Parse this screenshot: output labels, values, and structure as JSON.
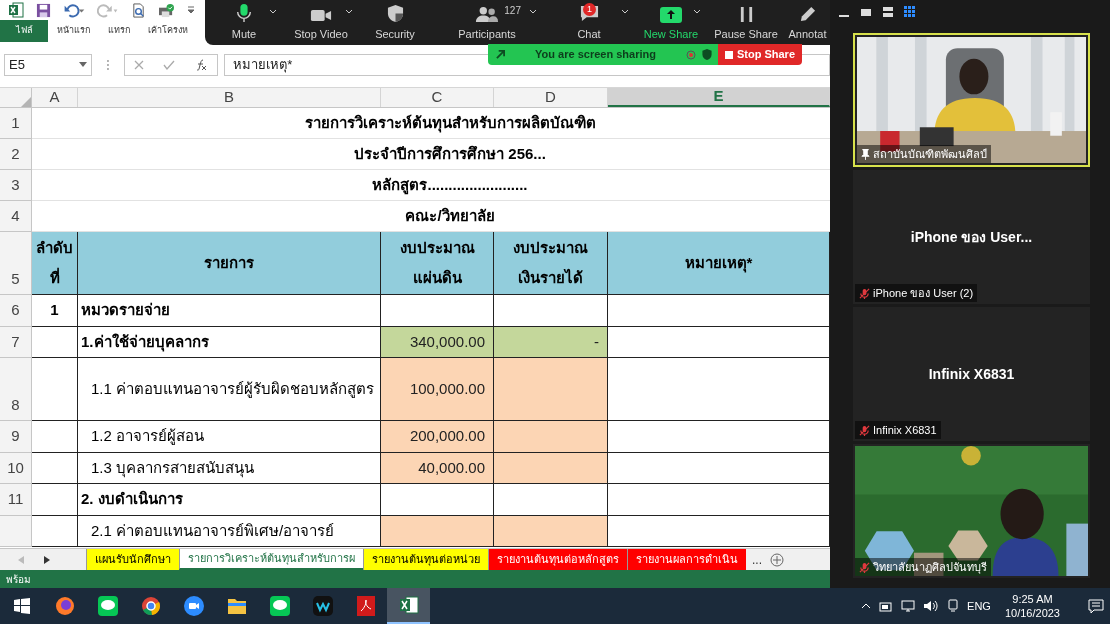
{
  "excel": {
    "ribbon_tabs": [
      {
        "label": "ไฟล์",
        "selected": true
      },
      {
        "label": "หน้าแรก",
        "selected": false
      },
      {
        "label": "แทรก",
        "selected": false
      },
      {
        "label": "เค้าโครงห",
        "selected": false
      }
    ],
    "name_box": "E5",
    "formula": "หมายเหตุ*",
    "columns": [
      {
        "label": "A",
        "selected": false
      },
      {
        "label": "B",
        "selected": false
      },
      {
        "label": "C",
        "selected": false
      },
      {
        "label": "D",
        "selected": false
      },
      {
        "label": "E",
        "selected": true
      }
    ],
    "rows": [
      {
        "number": "1",
        "kind": "title",
        "text": "รายการวิเคราะห์ต้นทุนสำหรับการผลิตบัณฑิต"
      },
      {
        "number": "2",
        "kind": "title",
        "text": "ประจำปีการศึการศึกษา 256..."
      },
      {
        "number": "3",
        "kind": "title",
        "text": "หลักสูตร........................"
      },
      {
        "number": "4",
        "kind": "title",
        "text": "คณะ/วิทยาลัย"
      },
      {
        "number": "5",
        "kind": "header",
        "cells": [
          [
            "ลำดับ",
            "ที่"
          ],
          [
            "รายการ"
          ],
          [
            "งบประมาณ",
            "แผ่นดิน"
          ],
          [
            "งบประมาณ",
            "เงินรายได้"
          ],
          [
            "หมายเหตุ*"
          ]
        ]
      },
      {
        "number": "6",
        "kind": "data",
        "tall": false,
        "no": "1",
        "item": {
          "text": "หมวดรายจ่าย",
          "kind": "section"
        }
      },
      {
        "number": "7",
        "kind": "data",
        "tall": false,
        "item": {
          "text": "1.ค่าใช้จ่ายบุคลากร",
          "kind": "section"
        },
        "amounts": [
          {
            "text": "340,000.00",
            "color": "#c4d79b"
          },
          {
            "text": "-",
            "color": "#c4d79b"
          }
        ]
      },
      {
        "number": "8",
        "kind": "data",
        "tall": true,
        "item": {
          "text": "1.1 ค่าตอบแทนอาจารย์ผู้รับผิดชอบหลักสูตร",
          "kind": "subitem"
        },
        "amounts": [
          {
            "text": "100,000.00",
            "color": "#fcd5b4"
          },
          {
            "color": "#fcd5b4"
          }
        ]
      },
      {
        "number": "9",
        "kind": "data",
        "tall": false,
        "item": {
          "text": "1.2 อาจารย์ผู้สอน",
          "kind": "subitem"
        },
        "amounts": [
          {
            "text": "200,000.00",
            "color": "#fcd5b4"
          },
          {
            "color": "#fcd5b4"
          }
        ]
      },
      {
        "number": "10",
        "kind": "data",
        "tall": false,
        "item": {
          "text": "1.3 บุคลากรสายสนับสนุน",
          "kind": "subitem"
        },
        "amounts": [
          {
            "text": "40,000.00",
            "color": "#fcd5b4"
          },
          {
            "color": "#fcd5b4"
          }
        ]
      },
      {
        "number": "11",
        "kind": "data",
        "tall": false,
        "item": {
          "text": "2. งบดำเนินการ",
          "kind": "section"
        }
      },
      {
        "kind": "data",
        "tall": false,
        "item": {
          "text": "2.1 ค่าตอบแทนอาจารย์พิเศษ/อาจารย์",
          "kind": "subitem"
        },
        "amounts": [
          {
            "color": "#fcd5b4"
          },
          {
            "color": "#fcd5b4"
          }
        ]
      }
    ],
    "sheet_tabs": [
      {
        "label": "แผนรับนักศึกษา",
        "color": "#ffff00",
        "selected": false
      },
      {
        "label": "รายการวิเคราะห์ต้นทุนสำหรับการผ",
        "color": "#ffffff",
        "selected": true
      },
      {
        "label": "รายงานต้นทุนต่อหน่วย",
        "color": "#ffff00",
        "selected": false
      },
      {
        "label": "รายงานต้นทุนต่อหลักสูตร",
        "color": "#ff0000",
        "selected": false
      },
      {
        "label": "รายงานผลการดำเนิน",
        "color": "#ff0000",
        "selected": false
      }
    ],
    "more_tabs": "...",
    "status": "พร้อม"
  },
  "zoom": {
    "toolbar": [
      {
        "kind": "mic",
        "label": "Mute",
        "menu": true,
        "highlighted": false
      },
      {
        "kind": "video",
        "label": "Stop Video",
        "menu": true,
        "highlighted": false
      },
      {
        "kind": "shield",
        "label": "Security",
        "menu": false,
        "highlighted": false
      },
      {
        "kind": "people",
        "label": "Participants",
        "menu": true,
        "count": "127",
        "highlighted": false
      },
      {
        "kind": "chat",
        "label": "Chat",
        "menu": true,
        "badge": "1",
        "highlighted": false
      },
      {
        "kind": "share",
        "label": "New Share",
        "menu": true,
        "highlighted": true
      },
      {
        "kind": "pause",
        "label": "Pause Share",
        "menu": false,
        "highlighted": false
      },
      {
        "kind": "pencil",
        "label": "Annotat",
        "menu": false,
        "highlighted": false
      }
    ],
    "banner": {
      "text": "You are screen sharing",
      "stop": "Stop Share"
    },
    "view_buttons": [
      {
        "kind": "minimize",
        "selected": false
      },
      {
        "kind": "single",
        "selected": false
      },
      {
        "kind": "strip",
        "selected": false
      },
      {
        "kind": "grid",
        "selected": true
      }
    ],
    "tiles": [
      {
        "kind": "video",
        "name": "สถาบันบัณฑิตพัฒนศิลป์",
        "pinned": true,
        "muted": false,
        "speaking": true
      },
      {
        "kind": "name",
        "title": "iPhone ของ User...",
        "name": "iPhone ของ User (2)",
        "pinned": false,
        "muted": true,
        "speaking": false
      },
      {
        "kind": "name",
        "title": "Infinix X6831",
        "name": "Infinix X6831",
        "pinned": false,
        "muted": true,
        "speaking": false
      },
      {
        "kind": "video",
        "name": "วิทยาลัยนาฏศิลปจันทบุรี",
        "pinned": false,
        "muted": true,
        "speaking": false
      }
    ]
  },
  "taskbar": {
    "apps": [
      {
        "kind": "start",
        "active": false
      },
      {
        "kind": "firefox",
        "active": false
      },
      {
        "kind": "line",
        "active": false
      },
      {
        "kind": "chrome",
        "active": false
      },
      {
        "kind": "zoom",
        "active": false
      },
      {
        "kind": "folder",
        "active": false
      },
      {
        "kind": "line",
        "active": false
      },
      {
        "kind": "webex",
        "active": false
      },
      {
        "kind": "acrobat",
        "active": false
      },
      {
        "kind": "excel",
        "active": true
      }
    ],
    "language": "ENG",
    "time": "9:25 AM",
    "date": "10/16/2023"
  }
}
